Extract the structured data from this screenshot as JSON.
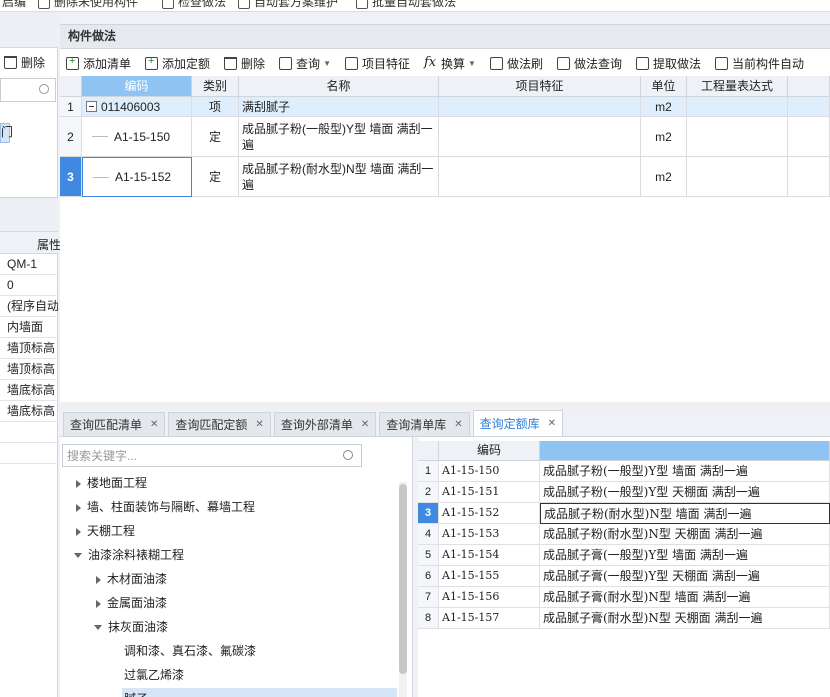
{
  "top_toolbar": {
    "items": [
      "启编",
      "删除未使用构件",
      "检查做法",
      "自动套方案维护",
      "批量自动套做法"
    ]
  },
  "left_top": {
    "delete_label": "删除",
    "selected_fragment": "门"
  },
  "left_props": {
    "header": "属性",
    "rows": [
      "QM-1",
      "0",
      "(程序自动",
      "内墙面",
      "墙顶标高",
      "墙顶标高",
      "墙底标高",
      "墙底标高"
    ]
  },
  "main": {
    "title": "构件做法",
    "toolbar": [
      {
        "label": "添加清单",
        "icon": "add-list-icon"
      },
      {
        "label": "添加定额",
        "icon": "add-quota-icon"
      },
      {
        "label": "删除",
        "icon": "trash-icon"
      },
      {
        "label": "查询",
        "icon": "query-icon",
        "dropdown": true
      },
      {
        "label": "项目特征",
        "icon": "feature-icon"
      },
      {
        "label": "换算",
        "icon": "fx-icon",
        "dropdown": true
      },
      {
        "label": "做法刷",
        "icon": "brush-icon"
      },
      {
        "label": "做法查询",
        "icon": "method-query-icon"
      },
      {
        "label": "提取做法",
        "icon": "extract-icon"
      },
      {
        "label": "当前构件自动",
        "icon": "auto-icon"
      }
    ],
    "columns": [
      "编码",
      "类别",
      "名称",
      "项目特征",
      "单位",
      "工程量表达式"
    ],
    "rows": [
      {
        "num": "1",
        "code": "011406003",
        "type": "项",
        "name": "满刮腻子",
        "feature": "",
        "unit": "m2",
        "expr": ""
      },
      {
        "num": "2",
        "code": "A1-15-150",
        "type": "定",
        "name": "成品腻子粉(一般型)Y型 墙面 满刮一遍",
        "feature": "",
        "unit": "m2",
        "expr": ""
      },
      {
        "num": "3",
        "code": "A1-15-152",
        "type": "定",
        "name": "成品腻子粉(耐水型)N型 墙面 满刮一遍",
        "feature": "",
        "unit": "m2",
        "expr": ""
      }
    ]
  },
  "bottom_tabs": [
    "查询匹配清单",
    "查询匹配定额",
    "查询外部清单",
    "查询清单库",
    "查询定额库"
  ],
  "active_tab": "查询定额库",
  "tree": {
    "search_placeholder": "搜索关键字...",
    "nodes": [
      {
        "label": "楼地面工程",
        "level": 0,
        "expand": "collapsed"
      },
      {
        "label": "墙、柱面装饰与隔断、幕墙工程",
        "level": 0,
        "expand": "collapsed"
      },
      {
        "label": "天棚工程",
        "level": 0,
        "expand": "collapsed"
      },
      {
        "label": "油漆涂料裱糊工程",
        "level": 0,
        "expand": "expanded"
      },
      {
        "label": "木材面油漆",
        "level": 1,
        "expand": "collapsed"
      },
      {
        "label": "金属面油漆",
        "level": 1,
        "expand": "collapsed"
      },
      {
        "label": "抹灰面油漆",
        "level": 1,
        "expand": "expanded"
      },
      {
        "label": "调和漆、真石漆、氟碳漆",
        "level": 2,
        "expand": "leaf"
      },
      {
        "label": "过氯乙烯漆",
        "level": 2,
        "expand": "leaf"
      },
      {
        "label": "腻子",
        "level": 2,
        "expand": "leaf",
        "selected": true
      }
    ]
  },
  "quota": {
    "columns": [
      "编码",
      ""
    ],
    "rows": [
      {
        "num": "1",
        "code": "A1-15-150",
        "name": "成品腻子粉(一般型)Y型 墙面 满刮一遍"
      },
      {
        "num": "2",
        "code": "A1-15-151",
        "name": "成品腻子粉(一般型)Y型 天棚面 满刮一遍"
      },
      {
        "num": "3",
        "code": "A1-15-152",
        "name": "成品腻子粉(耐水型)N型 墙面 满刮一遍",
        "selected": true
      },
      {
        "num": "4",
        "code": "A1-15-153",
        "name": "成品腻子粉(耐水型)N型 天棚面 满刮一遍"
      },
      {
        "num": "5",
        "code": "A1-15-154",
        "name": "成品腻子膏(一般型)Y型 墙面 满刮一遍"
      },
      {
        "num": "6",
        "code": "A1-15-155",
        "name": "成品腻子膏(一般型)Y型 天棚面 满刮一遍"
      },
      {
        "num": "7",
        "code": "A1-15-156",
        "name": "成品腻子膏(耐水型)N型 墙面 满刮一遍"
      },
      {
        "num": "8",
        "code": "A1-15-157",
        "name": "成品腻子膏(耐水型)N型 天棚面 满刮一遍"
      }
    ]
  },
  "colors": {
    "accent": "#3f8ae0",
    "header_active": "#8fc3f2",
    "row_highlight": "#dfeefc",
    "tab_active_text": "#2f7fd6"
  }
}
